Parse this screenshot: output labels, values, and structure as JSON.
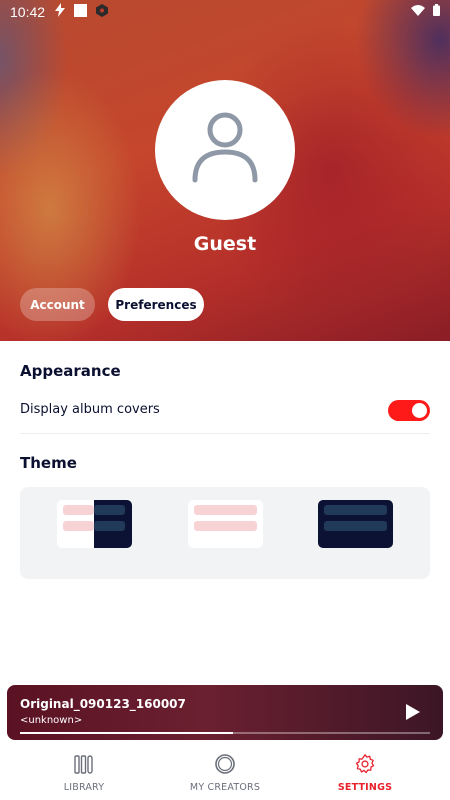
{
  "status_bar": {
    "time": "10:42",
    "icons": [
      "flash-icon",
      "square-icon",
      "app-badge-icon",
      "wifi-icon",
      "battery-icon"
    ]
  },
  "profile": {
    "username": "Guest",
    "avatar_icon": "user-icon"
  },
  "tabs": [
    {
      "label": "Account",
      "selected": false
    },
    {
      "label": "Preferences",
      "selected": true
    }
  ],
  "appearance": {
    "title": "Appearance",
    "display_album_covers": {
      "label": "Display album covers",
      "enabled": true
    }
  },
  "theme": {
    "title": "Theme",
    "options": [
      "system-theme",
      "light-theme",
      "dark-theme"
    ]
  },
  "mini_player": {
    "title": "Original_090123_160007",
    "artist": "<unknown>",
    "progress": 0.52,
    "play_icon": "play-icon"
  },
  "bottom_nav": [
    {
      "label": "LIBRARY",
      "icon": "library-icon",
      "active": false
    },
    {
      "label": "MY CREATORS",
      "icon": "creators-icon",
      "active": false
    },
    {
      "label": "SETTINGS",
      "icon": "gear-icon",
      "active": true
    }
  ],
  "colors": {
    "accent": "#e8212b",
    "toggle_on": "#ff1a1a",
    "text_primary": "#0b1030",
    "nav_inactive": "#6b6f7a",
    "theme_pink": "#f8d3d6",
    "theme_dark": "#0b1234",
    "theme_dark_bar": "#213a5a"
  }
}
